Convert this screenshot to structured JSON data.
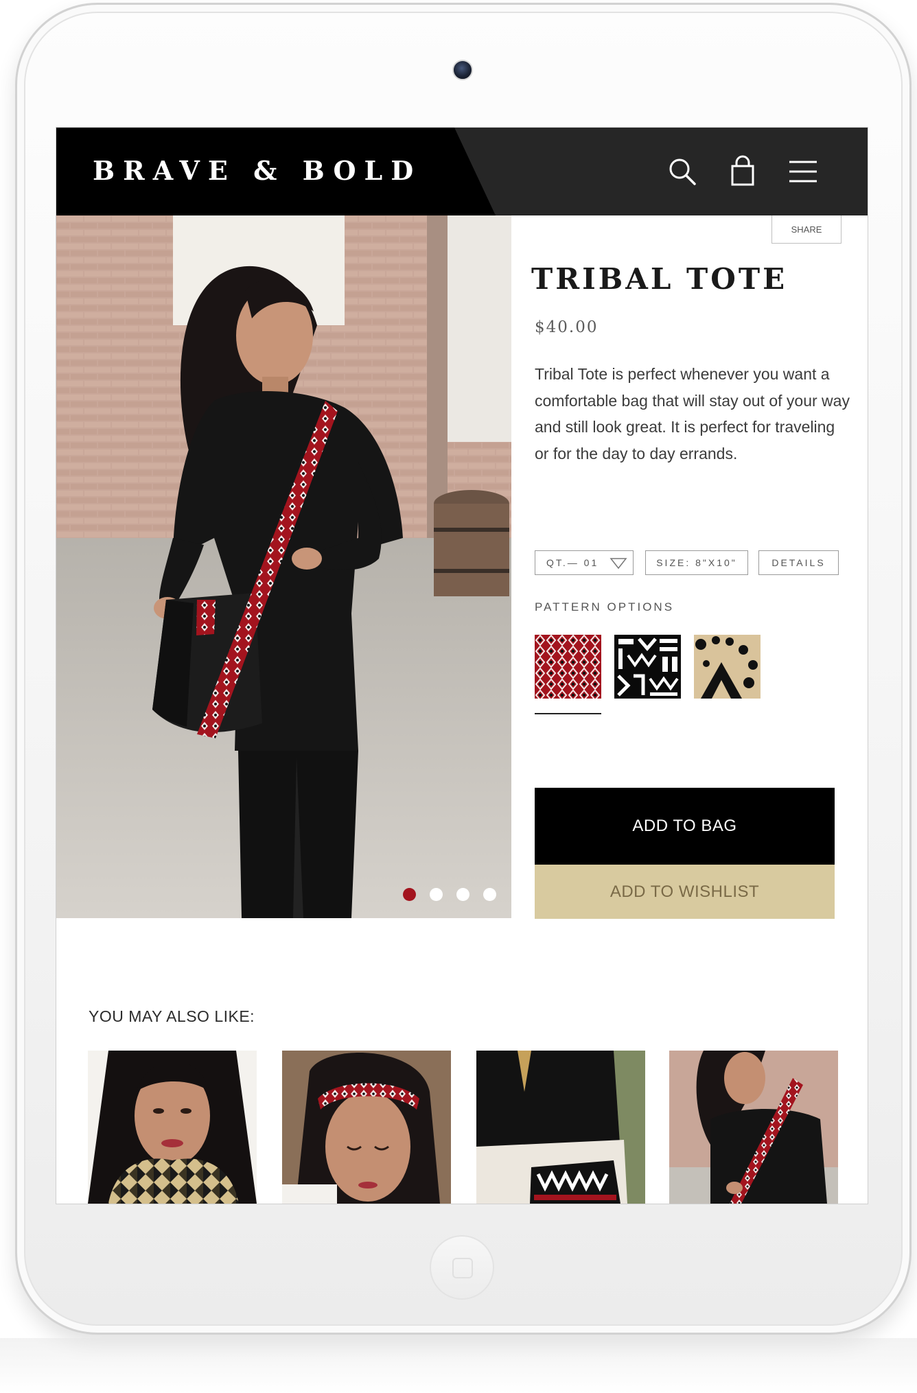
{
  "brand": {
    "logo_text": "BRAVE & BOLD"
  },
  "header": {
    "icons": [
      "search-icon",
      "shopping-bag-icon",
      "menu-icon"
    ]
  },
  "product": {
    "share_label": "SHARE",
    "title": "TRIBAL TOTE",
    "price": "$40.00",
    "description": "Tribal Tote is perfect whenever you want a comfortable bag that will stay out of your way and still look great. It is perfect for traveling or for the day to day errands.",
    "qty_label": "QT.— 01",
    "size_label": "SIZE: 8\"X10\"",
    "details_label": "DETAILS",
    "pattern_options_label": "PATTERN OPTIONS",
    "patterns": [
      "red-diamond-pattern",
      "white-tribal-pattern",
      "tan-dot-pattern"
    ],
    "selected_pattern": 0,
    "add_to_bag_label": "ADD TO BAG",
    "add_to_wishlist_label": "ADD TO WISHLIST"
  },
  "gallery": {
    "slide_count": 4,
    "active_slide": 1
  },
  "recommendations": {
    "heading": "YOU MAY ALSO LIKE:",
    "items": [
      "tribal-scarf",
      "tribal-headband",
      "tribal-clutch",
      "tribal-tote"
    ]
  },
  "colors": {
    "header_bg": "#262626",
    "logo_block_bg": "#000000",
    "accent_red": "#a3141e",
    "wishlist_bg": "#d8ca9f",
    "wishlist_text": "#7a6a47"
  }
}
